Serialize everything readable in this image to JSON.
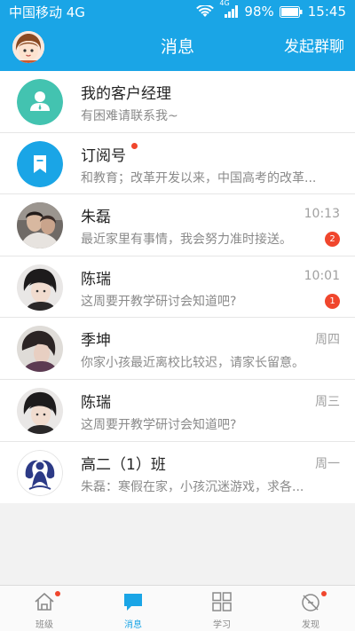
{
  "statusbar": {
    "carrier": "中国移动 4G",
    "network": "4G",
    "battery": "98%",
    "time": "15:45"
  },
  "header": {
    "title": "消息",
    "action": "发起群聊"
  },
  "conversations": [
    {
      "name": "我的客户经理",
      "message": "有困难请联系我~",
      "time": "",
      "badge": "",
      "avatar": "manager-icon",
      "unread_dot": false
    },
    {
      "name": "订阅号",
      "message": "和教育；改革开发以来，中国高考的改革...",
      "time": "",
      "badge": "",
      "avatar": "bookmark-icon",
      "unread_dot": true
    },
    {
      "name": "朱磊",
      "message": "最近家里有事情，我会努力准时接送。",
      "time": "10:13",
      "badge": "2",
      "avatar": "user-photo",
      "unread_dot": false
    },
    {
      "name": "陈瑞",
      "message": "这周要开教学研讨会知道吧?",
      "time": "10:01",
      "badge": "1",
      "avatar": "user-photo",
      "unread_dot": false
    },
    {
      "name": "季坤",
      "message": "你家小孩最近离校比较迟，请家长留意。",
      "time": "周四",
      "badge": "",
      "avatar": "user-photo",
      "unread_dot": false
    },
    {
      "name": "陈瑞",
      "message": "这周要开教学研讨会知道吧?",
      "time": "周三",
      "badge": "",
      "avatar": "user-photo",
      "unread_dot": false
    },
    {
      "name": "高二（1）班",
      "message": "朱磊：寒假在家，小孩沉迷游戏，求各...",
      "time": "周一",
      "badge": "",
      "avatar": "class-logo",
      "unread_dot": false
    }
  ],
  "tabs": [
    {
      "label": "班级",
      "icon": "home-icon",
      "active": false,
      "dot": true
    },
    {
      "label": "消息",
      "icon": "chat-icon",
      "active": true,
      "dot": false
    },
    {
      "label": "学习",
      "icon": "grid-icon",
      "active": false,
      "dot": false
    },
    {
      "label": "发现",
      "icon": "compass-icon",
      "active": false,
      "dot": true
    }
  ],
  "colors": {
    "accent": "#1aa5e6",
    "badge": "#f0462d",
    "manager_avatar": "#43c3b0"
  }
}
